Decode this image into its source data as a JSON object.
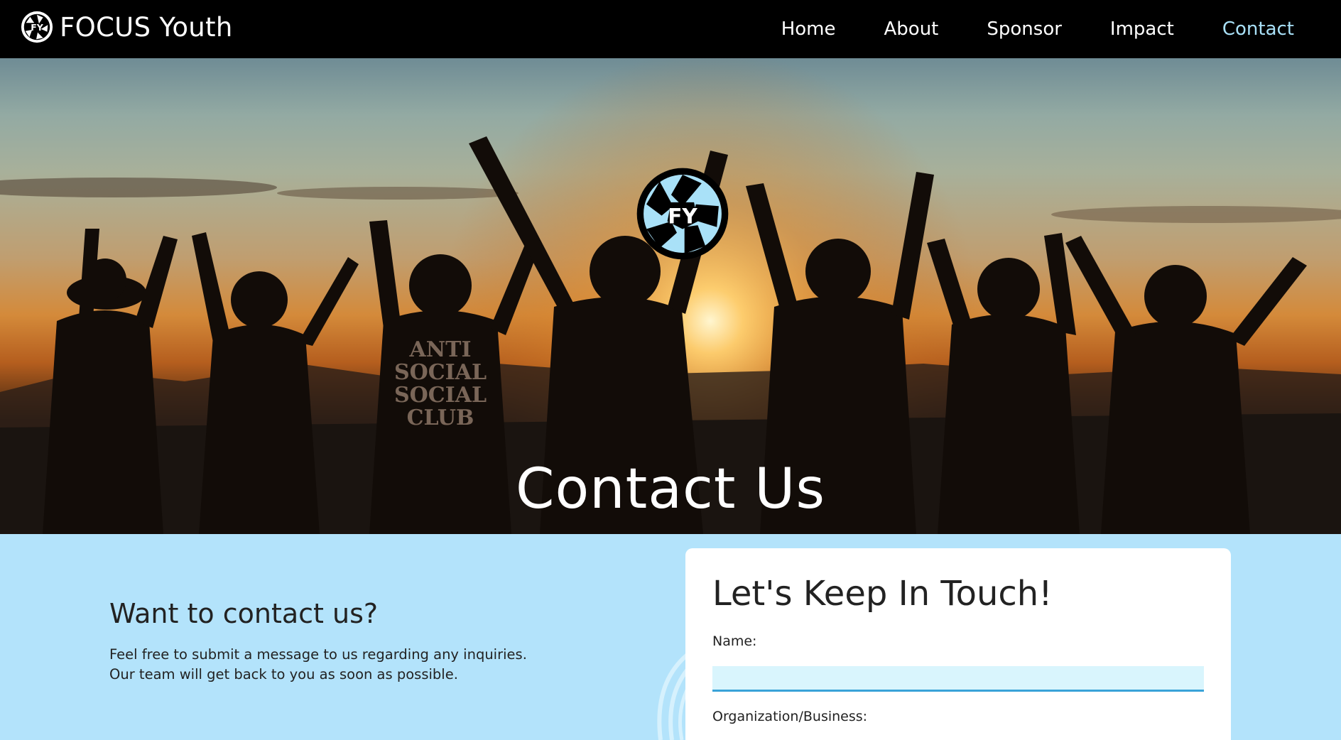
{
  "nav": {
    "brand": "FOCUS Youth",
    "links": [
      {
        "label": "Home",
        "active": false
      },
      {
        "label": "About",
        "active": false
      },
      {
        "label": "Sponsor",
        "active": false
      },
      {
        "label": "Impact",
        "active": false
      },
      {
        "label": "Contact",
        "active": true
      }
    ]
  },
  "hero": {
    "title": "Contact Us",
    "logo_icon": "camera-aperture-icon",
    "hoodie_text": [
      "ANTI",
      "SOCIAL",
      "SOCIAL",
      "CLUB"
    ]
  },
  "contact": {
    "heading": "Want to contact us?",
    "lines": [
      "Feel free to submit a message to us regarding any inquiries.",
      "Our team will get back to you as soon as possible."
    ]
  },
  "form": {
    "title": "Let's Keep In Touch!",
    "name_label": "Name:",
    "name_value": "",
    "org_label": "Organization/Business:"
  },
  "colors": {
    "nav_bg": "#000000",
    "nav_active": "#a9e1f8",
    "section_bg": "#b3e3fb",
    "input_bg": "#d9f5fd",
    "input_border": "#3aa3d8",
    "logo_fill": "#a9e1f8"
  }
}
